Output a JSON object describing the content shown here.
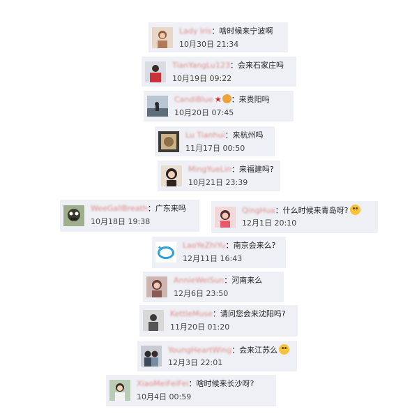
{
  "comments": [
    {
      "username": "Lady Iris",
      "text": "：啥时候来宁波啊",
      "time": "10月30日 21:34",
      "avatar_icon": "avatar-woman-icon"
    },
    {
      "username": "TianYangLu123",
      "text": "：会来石家庄吗",
      "time": "10月19日 09:22",
      "avatar_icon": "avatar-woman-icon"
    },
    {
      "username": "CandiBlue",
      "text": "：来贵阳吗",
      "time": "10月20日 07:45",
      "avatar_icon": "avatar-landscape-icon"
    },
    {
      "username": "Lu Tianhui",
      "text": "：来杭州吗",
      "time": "11月17日 00:50",
      "avatar_icon": "avatar-cat-icon"
    },
    {
      "username": "MingYueLin",
      "text": "：来福建吗?",
      "time": "10月21日 23:39",
      "avatar_icon": "avatar-woman-icon"
    },
    {
      "username": "WeeGallBreath",
      "text": "：广东来吗",
      "time": "10月18日 19:38",
      "avatar_icon": "avatar-cartoon-icon"
    },
    {
      "username": "QingHua",
      "text": "：什么时候来青岛呀?",
      "time": "12月1日 20:10",
      "avatar_icon": "avatar-woman-icon"
    },
    {
      "username": "LaoYeZhiYu",
      "text": "：南京会来么?",
      "time": "12月11日 16:43",
      "avatar_icon": "avatar-default-icon"
    },
    {
      "username": "AnnieWeiSun",
      "text": "：河南来么",
      "time": "12月6日 23:50",
      "avatar_icon": "avatar-woman-icon"
    },
    {
      "username": "KettleMuse",
      "text": "：请问您会来沈阳吗?",
      "time": "11月20日 01:20",
      "avatar_icon": "avatar-person-icon"
    },
    {
      "username": "YoungHeartWing",
      "text": "：会来江苏么",
      "time": "12月3日 22:01",
      "avatar_icon": "avatar-couple-icon"
    },
    {
      "username": "XiaoMeiFeiFei",
      "text": "：啥时候来长沙呀?",
      "time": "10月4日 00:59",
      "avatar_icon": "avatar-woman-icon"
    }
  ]
}
